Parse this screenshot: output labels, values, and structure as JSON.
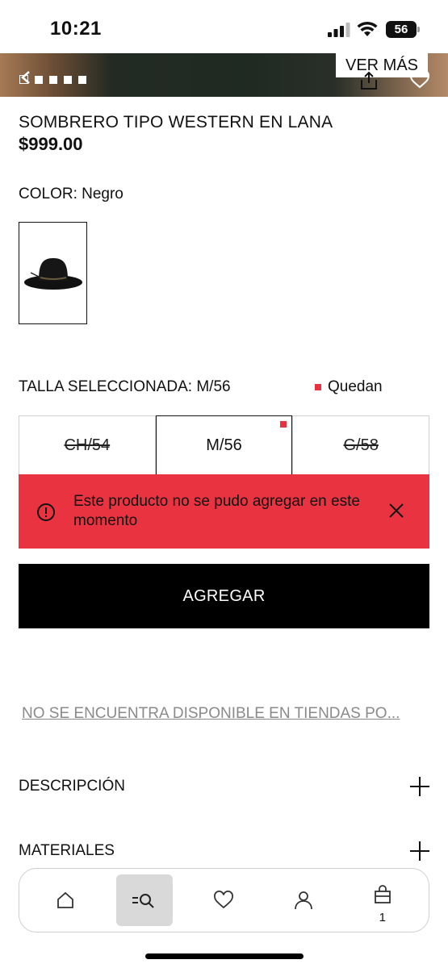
{
  "status_bar": {
    "time": "10:21",
    "battery": "56"
  },
  "gallery": {
    "ver_mas_label": "VER MÁS",
    "dot_count": 5
  },
  "product": {
    "name": "SOMBRERO TIPO WESTERN EN LANA",
    "price": "$999.00",
    "color_label": "COLOR: Negro",
    "size_label": "TALLA SELECCIONADA: M/56",
    "stock_text": "Quedan"
  },
  "sizes": [
    {
      "label": "CH/54",
      "available": false
    },
    {
      "label": "M/56",
      "available": true,
      "selected": true
    },
    {
      "label": "G/58",
      "available": false
    }
  ],
  "error": {
    "message": "Este producto no se pudo agregar en este momento"
  },
  "add_button_label": "AGREGAR",
  "availability_link": "NO SE ENCUENTRA DISPONIBLE EN TIENDAS PO...",
  "accordions": {
    "description": "DESCRIPCIÓN",
    "materials": "MATERIALES"
  },
  "bottom_nav": {
    "cart_count": "1",
    "items": [
      "home-icon",
      "search-menu-icon",
      "heart-icon",
      "user-icon",
      "bag-icon"
    ],
    "active": "search-menu-icon"
  },
  "colors": {
    "error": "#ea3340",
    "accent_red": "#e8323f",
    "button_bg": "#000000"
  }
}
